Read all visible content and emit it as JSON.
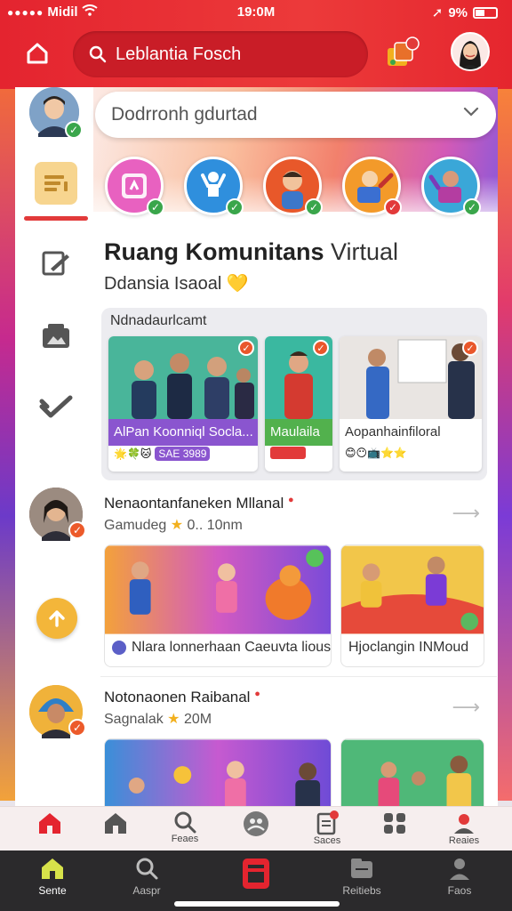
{
  "status_bar": {
    "dots": "●●●●●",
    "carrier": "Midil",
    "time": "19:0M",
    "battery_text": "9%"
  },
  "header": {
    "search_text": "Leblantia Fosch"
  },
  "selector": {
    "value": "Dodrronh gdurtad"
  },
  "page": {
    "title_bold": "Ruang Komunitans",
    "title_light": "Virtual",
    "subtitle": "Ddansia Isaoal",
    "heart": "💛"
  },
  "featured": {
    "label": "Ndnadaurlcamt",
    "cards": [
      {
        "caption": "AlPan Koonniql Socla...",
        "footer": "SAE 3989",
        "caption_color": "#8a55cf"
      },
      {
        "caption": "Maulaila",
        "footer": "",
        "caption_color": "#52b14d"
      },
      {
        "caption": "Aopanhainfiloral",
        "footer": "",
        "caption_color": "#ffffff"
      }
    ]
  },
  "posts": [
    {
      "title": "Nenaontanfaneken Mllanal",
      "meta_left": "Gamudeg",
      "meta_right": "0.. 10nm",
      "cards": [
        {
          "caption": "Nlara lonnerhaan Caeuvta lious"
        },
        {
          "caption": "Hjoclangin INMoud"
        }
      ]
    },
    {
      "title": "Notonaonen Raibanal",
      "meta_left": "Sagnalak",
      "meta_right": "20M",
      "cards": []
    }
  ],
  "bottom_nav_top": [
    {
      "label": ""
    },
    {
      "label": ""
    },
    {
      "label": "Feaes"
    },
    {
      "label": ""
    },
    {
      "label": "Saces"
    },
    {
      "label": ""
    },
    {
      "label": "Reaies"
    }
  ],
  "bottom_nav": [
    {
      "label": "Sente"
    },
    {
      "label": "Aaspr"
    },
    {
      "label": ""
    },
    {
      "label": "Reitiebs"
    },
    {
      "label": "Faos"
    }
  ],
  "colors": {
    "brand_red": "#e4242f",
    "accent_yellow": "#f3b63a",
    "check_green": "#3aa64b"
  }
}
